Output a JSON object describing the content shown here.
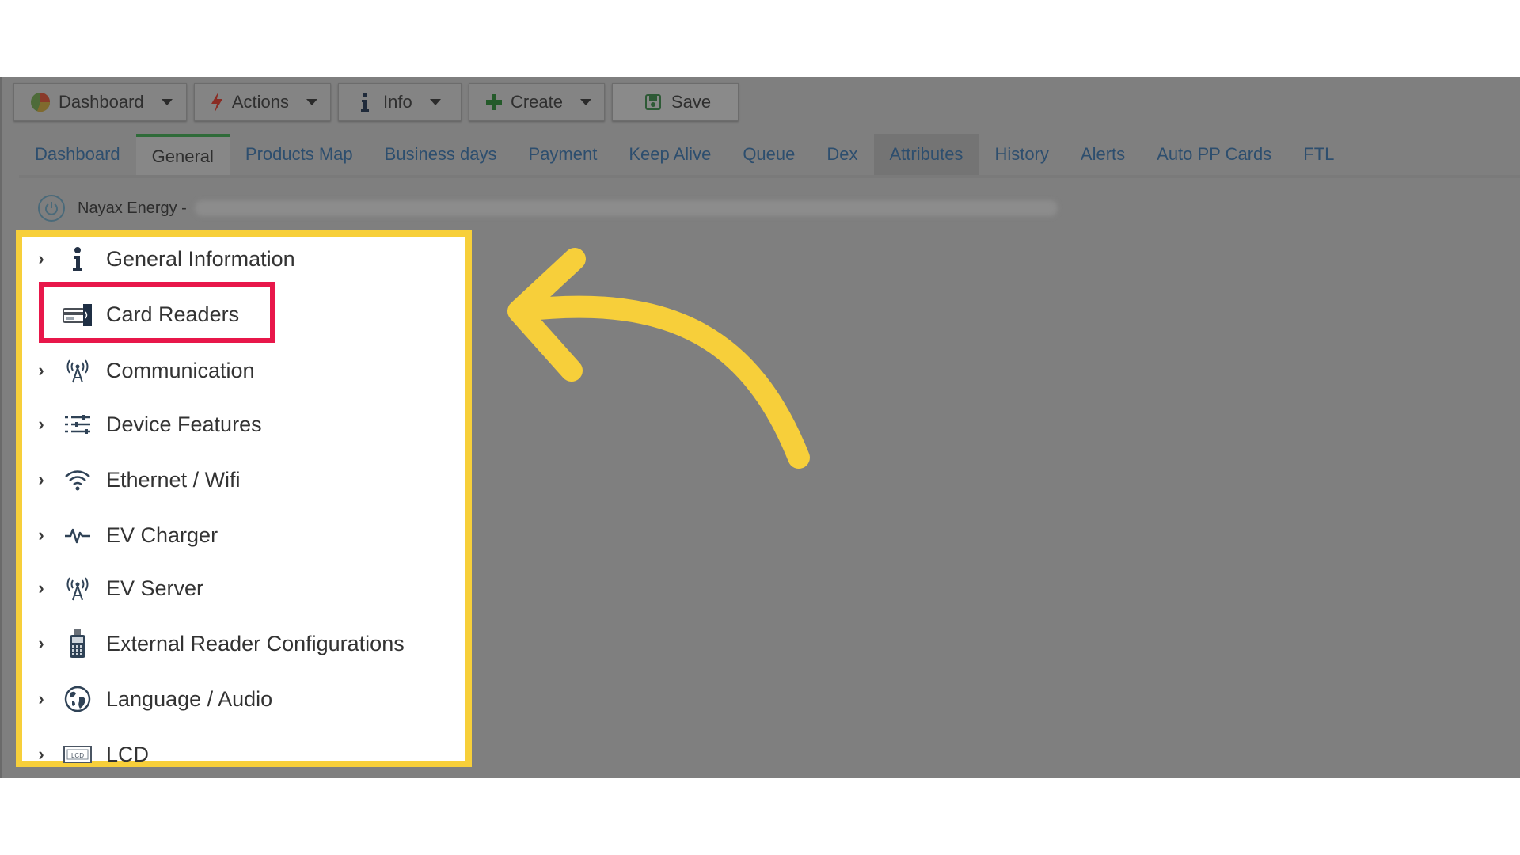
{
  "toolbar": {
    "dashboard": "Dashboard",
    "actions": "Actions",
    "info": "Info",
    "create": "Create",
    "save": "Save"
  },
  "tabs": [
    "Dashboard",
    "General",
    "Products Map",
    "Business days",
    "Payment",
    "Keep Alive",
    "Queue",
    "Dex",
    "Attributes",
    "History",
    "Alerts",
    "Auto PP Cards",
    "FTL"
  ],
  "active_tab": "General",
  "device": {
    "name": "Nayax Energy -"
  },
  "tree": {
    "items": [
      {
        "label": "General Information",
        "icon": "info-icon"
      },
      {
        "label": "Card Readers",
        "icon": "card-reader-icon"
      },
      {
        "label": "Communication",
        "icon": "antenna-icon"
      },
      {
        "label": "Device Features",
        "icon": "list-settings-icon"
      },
      {
        "label": "Ethernet / Wifi",
        "icon": "wifi-icon"
      },
      {
        "label": "EV Charger",
        "icon": "pulse-icon"
      },
      {
        "label": "EV Server",
        "icon": "antenna-icon"
      },
      {
        "label": "External Reader Configurations",
        "icon": "card-terminal-icon"
      },
      {
        "label": "Language / Audio",
        "icon": "globe-icon"
      },
      {
        "label": "LCD",
        "icon": "lcd-icon"
      }
    ]
  },
  "colors": {
    "highlight_frame": "#f7cf3a",
    "selection_box": "#e8174a",
    "arrow": "#f7cf3a",
    "overlay": "#7f7f7f",
    "active_tab_accent": "#2f6b39"
  }
}
